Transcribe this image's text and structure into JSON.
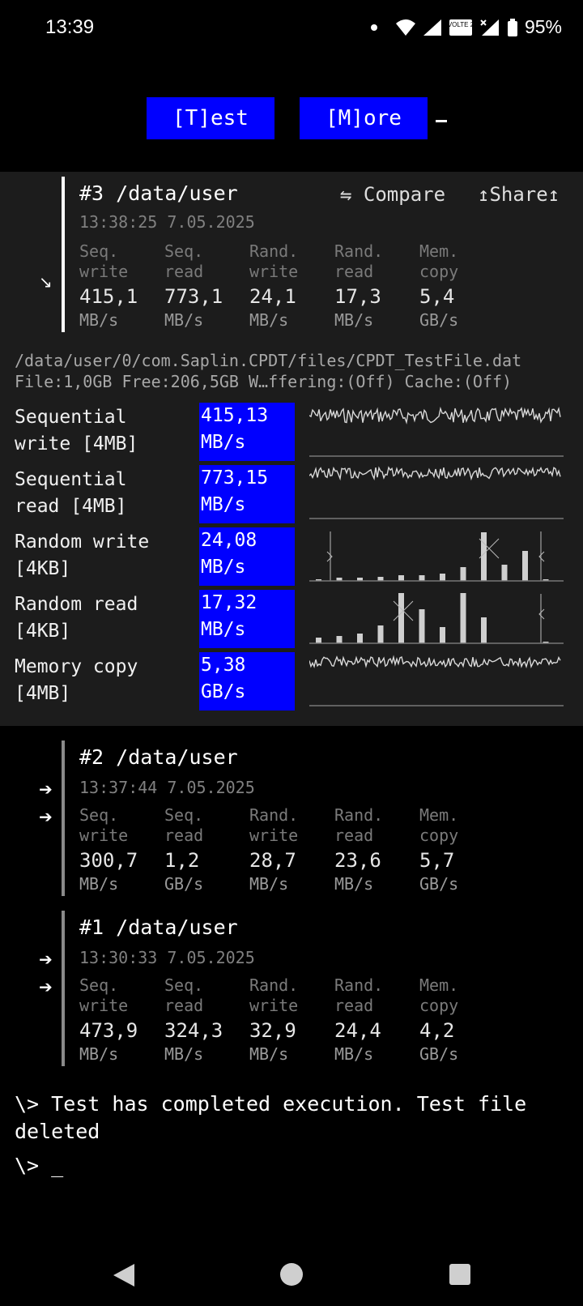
{
  "status": {
    "time": "13:39",
    "battery": "95%",
    "network_badge": "VOLTE 2"
  },
  "toolbar": {
    "test_label": "[T]est",
    "more_label": "[M]ore"
  },
  "current": {
    "title": "#3 /data/user",
    "timestamp": "13:38:25 7.05.2025",
    "compare_label": "⇋ Compare",
    "share_label": "↥Share↥",
    "metrics": [
      {
        "l1": "Seq.",
        "l2": "write",
        "value": "415,1",
        "unit": "MB/s"
      },
      {
        "l1": "Seq.",
        "l2": "read",
        "value": "773,1",
        "unit": "MB/s"
      },
      {
        "l1": "Rand.",
        "l2": "write",
        "value": "24,1",
        "unit": "MB/s"
      },
      {
        "l1": "Rand.",
        "l2": "read",
        "value": "17,3",
        "unit": "MB/s"
      },
      {
        "l1": "Mem.",
        "l2": "copy",
        "value": "5,4",
        "unit": "GB/s"
      }
    ],
    "file_path": "/data/user/0/com.Saplin.CPDT/files/CPDT_TestFile.dat",
    "file_info": "File:1,0GB Free:206,5GB W…ffering:(Off) Cache:(Off)",
    "rows": [
      {
        "label1": "Sequential",
        "label2": "write [4MB]",
        "value": "415,13",
        "unit": "MB/s"
      },
      {
        "label1": "Sequential",
        "label2": "read [4MB]",
        "value": "773,15",
        "unit": "MB/s"
      },
      {
        "label1": "Random write",
        "label2": "[4KB]",
        "value": "24,08",
        "unit": "MB/s"
      },
      {
        "label1": "Random read",
        "label2": "[4KB]",
        "value": "17,32",
        "unit": "MB/s"
      },
      {
        "label1": "Memory copy",
        "label2": "[4MB]",
        "value": "5,38",
        "unit": "GB/s"
      }
    ]
  },
  "history": [
    {
      "title": "#2 /data/user",
      "timestamp": "13:37:44 7.05.2025",
      "metrics": [
        {
          "l1": "Seq.",
          "l2": "write",
          "value": "300,7",
          "unit": "MB/s"
        },
        {
          "l1": "Seq.",
          "l2": "read",
          "value": "1,2",
          "unit": "GB/s"
        },
        {
          "l1": "Rand.",
          "l2": "write",
          "value": "28,7",
          "unit": "MB/s"
        },
        {
          "l1": "Rand.",
          "l2": "read",
          "value": "23,6",
          "unit": "MB/s"
        },
        {
          "l1": "Mem.",
          "l2": "copy",
          "value": "5,7",
          "unit": "GB/s"
        }
      ]
    },
    {
      "title": "#1 /data/user",
      "timestamp": "13:30:33 7.05.2025",
      "metrics": [
        {
          "l1": "Seq.",
          "l2": "write",
          "value": "473,9",
          "unit": "MB/s"
        },
        {
          "l1": "Seq.",
          "l2": "read",
          "value": "324,3",
          "unit": "MB/s"
        },
        {
          "l1": "Rand.",
          "l2": "write",
          "value": "32,9",
          "unit": "MB/s"
        },
        {
          "l1": "Rand.",
          "l2": "read",
          "value": "24,4",
          "unit": "MB/s"
        },
        {
          "l1": "Mem.",
          "l2": "copy",
          "value": "4,2",
          "unit": "GB/s"
        }
      ]
    }
  ],
  "console": {
    "message": "\\> Test has completed execution. Test file deleted",
    "prompt": "\\> _"
  },
  "colors": {
    "accent": "#0000ff",
    "panel": "#1c1c1c",
    "background": "#000000"
  }
}
